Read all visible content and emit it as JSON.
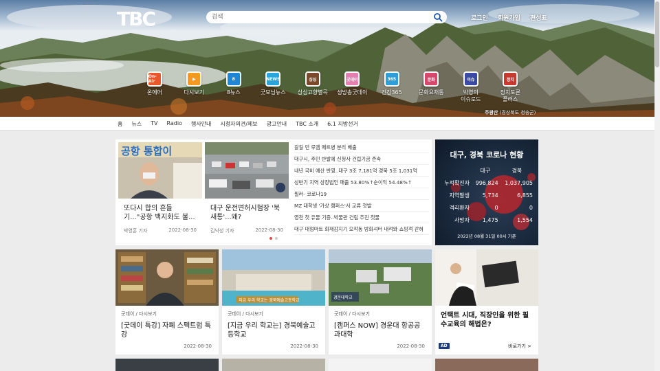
{
  "brand": {
    "logo_text": "TBC"
  },
  "search": {
    "placeholder": "검색"
  },
  "top_links": [
    "로그인",
    "회원가입",
    "편성표"
  ],
  "quick_menu": [
    {
      "label": "온에어",
      "icon": "on-air-icon",
      "badge": "On-Air",
      "color": "#e8562a"
    },
    {
      "label": "다시보기",
      "icon": "play-icon",
      "badge": "▶",
      "color": "#f29a1f"
    },
    {
      "label": "8뉴스",
      "icon": "news8-icon",
      "badge": "8",
      "color": "#1f86d6"
    },
    {
      "label": "굿모닝뉴스",
      "icon": "good-morning-icon",
      "badge": "NEWS",
      "color": "#2aa5d9"
    },
    {
      "label": "싱싱고향별곡",
      "icon": "hometown-icon",
      "badge": "싱싱",
      "color": "#7a4a2a"
    },
    {
      "label": "생방송굿데이",
      "icon": "good-day-icon",
      "badge": "굿데이",
      "color": "#e57fb0"
    },
    {
      "label": "건강365",
      "icon": "health-icon",
      "badge": "365",
      "color": "#2e9ed8"
    },
    {
      "label": "문화요채통",
      "icon": "culture-icon",
      "badge": "문화",
      "color": "#d6486b"
    },
    {
      "label": "박영의\n이슈로드",
      "icon": "issue-road-icon",
      "badge": "이슈",
      "color": "#3a4aa3"
    },
    {
      "label": "정치토론\n플러스",
      "icon": "politics-icon",
      "badge": "정치",
      "color": "#c7392e"
    }
  ],
  "location": {
    "name": "주왕산",
    "region": "(경상북도 청송군)"
  },
  "nav": [
    "홈",
    "뉴스",
    "TV",
    "Radio",
    "행사안내",
    "시청자의견/제보",
    "광고안내",
    "TBC 소개",
    "6.1 지방선거"
  ],
  "featured": [
    {
      "title": "또다시 합의 흔들 기...\"공항 백지화도 불...",
      "reporter": "박영훈 기자",
      "date": "2022-08-30",
      "overlay": "공항 통합이"
    },
    {
      "title": "대구 운전면허시험장 '북새통'...왜?",
      "reporter": "김낙성 기자",
      "date": "2022-08-30",
      "overlay": ""
    }
  ],
  "headlines": [
    "갈길 먼 루엠 페트병 분리 배출",
    "대구시, 주민 반발에 신청사 건립기금 존속",
    "내년 국비 예산 반영..대구 3조 7,181억 경북 5조 1,031억",
    "상반기 지역 상장법인 매출 53.80%↑순이익 54.48%↑",
    "필러- 코로나19",
    "MZ 대학생 '가상 캠퍼스'서 교류 첫발",
    "영천 첫 유물 기증..박물관 건립 추진 첫물",
    "대구 대형마트 화재감지기 오작동 방화셔터 내려와 쇼핑객 갇혀"
  ],
  "covid": {
    "title": "대구, 경북 코로나 현황",
    "columns": [
      "대구",
      "경북"
    ],
    "rows": [
      {
        "label": "누적확진자",
        "daegu": "996,824",
        "gyeongbuk": "1,037,905"
      },
      {
        "label": "지역발생",
        "daegu": "5,734",
        "gyeongbuk": "6,855"
      },
      {
        "label": "격리환자",
        "daegu": "0",
        "gyeongbuk": "0"
      },
      {
        "label": "사망자",
        "daegu": "1,475",
        "gyeongbuk": "1,554"
      }
    ],
    "footnote": "2022년 08월 31일 00시 기준"
  },
  "cards": [
    {
      "category": "굿데이 / 다시보기",
      "title": "[굿데이 특강] 자폐 스펙트럼 특강",
      "date": "2022-08-30"
    },
    {
      "category": "굿데이 / 다시보기",
      "title": "[지금 우리 학교는] 경북예술고등학교",
      "date": "2022-08-30",
      "overlay": "지금 우리 학교는 경북예술고등학교"
    },
    {
      "category": "굿데이 / 다시보기",
      "title": "[캠퍼스 NOW] 경운대 항공공과대학",
      "date": "2022-08-30",
      "overlay": "경운대학교"
    }
  ],
  "ad": {
    "title": "언택트 시대, 직장인을 위한 필수교육의 해법은?",
    "badge": "AD",
    "more": "바로가기 >"
  }
}
